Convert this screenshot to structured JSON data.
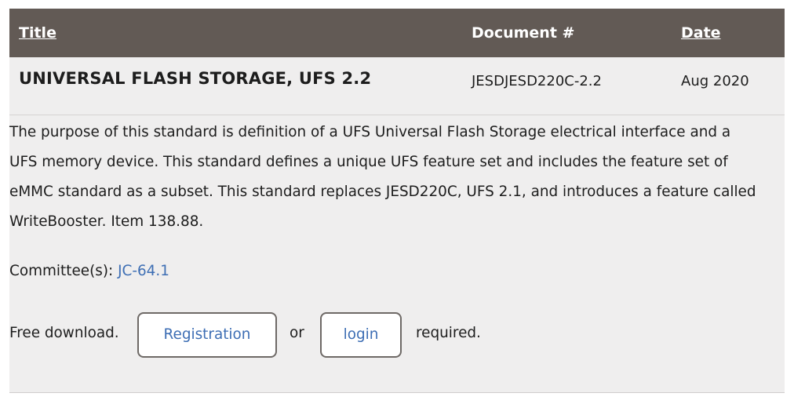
{
  "header": {
    "title_label": "Title",
    "document_label": "Document #",
    "date_label": "Date"
  },
  "standard": {
    "title": "UNIVERSAL FLASH STORAGE, UFS 2.2",
    "document_number": "JESDJESD220C-2.2",
    "date": "Aug 2020",
    "description": "The purpose of this standard is definition of a UFS Universal Flash Storage electrical interface and a UFS memory device. This standard defines a unique UFS feature set and includes the feature set of eMMC standard as a subset. This standard replaces JESD220C, UFS 2.1, and introduces a feature called WriteBooster.  Item 138.88.",
    "committee_label": "Committee(s):",
    "committee_link": "JC-64.1"
  },
  "download": {
    "prefix": "Free download.",
    "registration_button": "Registration",
    "or_text": "or",
    "login_button": "login",
    "suffix": "required."
  },
  "colors": {
    "header_bg": "#625a55",
    "panel_bg": "#efeeee",
    "link": "#3d6eb4"
  }
}
